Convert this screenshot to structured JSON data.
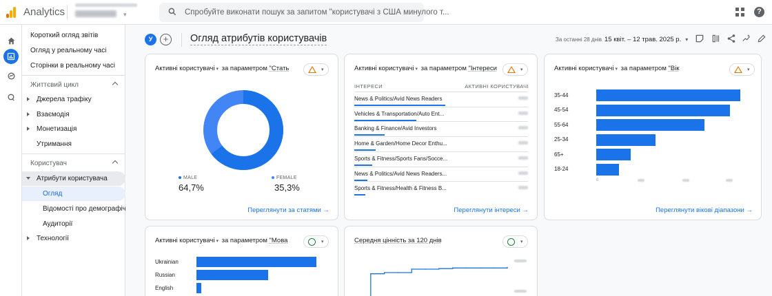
{
  "topbar": {
    "app_name": "Analytics",
    "search_placeholder": "Спробуйте виконати пошук за запитом \"користувачі з США минулого т...",
    "icons": [
      "analytics-logo-icon",
      "search-icon",
      "apps-grid-icon",
      "help-icon"
    ]
  },
  "rail": {
    "icons": [
      "home-icon",
      "reports-icon",
      "explore-icon",
      "advertising-icon"
    ]
  },
  "sidenav": {
    "items": [
      {
        "label": "Короткий огляд звітів"
      },
      {
        "label": "Огляд у реальному часі"
      },
      {
        "label": "Сторінки в реальному часі"
      },
      {
        "label": "Життєвий цикл"
      },
      {
        "label": "Джерела трафіку"
      },
      {
        "label": "Взаємодія"
      },
      {
        "label": "Монетизація"
      },
      {
        "label": "Утримання"
      },
      {
        "label": "Користувач"
      },
      {
        "label": "Атрибути користувача"
      },
      {
        "label": "Огляд"
      },
      {
        "label": "Відомості про демографіч..."
      },
      {
        "label": "Аудиторії"
      },
      {
        "label": "Технології"
      }
    ]
  },
  "header": {
    "avatar_letter": "У",
    "add_label": "+",
    "title": "Огляд атрибутів користувачів",
    "date_label": "За останні 28 днів",
    "date_value": "15 квіт. – 12 трав. 2025 р."
  },
  "cards": {
    "gender": {
      "metric": "Активні користувачі",
      "by": "за параметром",
      "dimension": "\"Стать",
      "status": "warning",
      "link": "Переглянути за статями →",
      "legend": [
        {
          "name": "MALE",
          "value": "64,7%",
          "color": "#1a73e8"
        },
        {
          "name": "FEMALE",
          "value": "35,3%",
          "color": "#4285f4"
        }
      ]
    },
    "interests": {
      "metric": "Активні користувачі",
      "by": "за параметром",
      "dimension": "\"Інтереси",
      "status": "warning",
      "col_name": "ІНТЕРЕСИ",
      "col_value": "АКТИВНІ КОРИСТУВАЧІ",
      "rows": [
        {
          "name": "News & Politics/Avid News Readers",
          "share": 0.97
        },
        {
          "name": "Vehicles & Transportation/Auto Ent...",
          "share": 0.66
        },
        {
          "name": "Banking & Finance/Avid Investors",
          "share": 0.32
        },
        {
          "name": "Home & Garden/Home Decor Enthu...",
          "share": 0.23
        },
        {
          "name": "Sports & Fitness/Sports Fans/Socce...",
          "share": 0.19
        },
        {
          "name": "News & Politics/Avid News Readers...",
          "share": 0.14
        },
        {
          "name": "Sports & Fitness/Health & Fitness B...",
          "share": 0.12
        }
      ],
      "link": "Переглянути інтереси →"
    },
    "age": {
      "metric": "Активні користувачі",
      "by": "за параметром",
      "dimension": "\"Вік",
      "status": "warning",
      "link": "Переглянути вікові діапазони →",
      "x_first_tick": "0"
    },
    "language": {
      "metric": "Активні користувачі",
      "by": "за параметром",
      "dimension": "\"Мова",
      "status": "ok"
    },
    "ltv": {
      "title": "Середня цінність за 120 днів",
      "status": "ok"
    }
  },
  "chart_data": [
    {
      "type": "pie",
      "categories": [
        "MALE",
        "FEMALE"
      ],
      "values": [
        64.7,
        35.3
      ]
    },
    {
      "type": "bar",
      "orientation": "horizontal",
      "categories": [
        "35-44",
        "45-54",
        "55-64",
        "25-34",
        "65+",
        "18-24"
      ],
      "values": [
        100,
        93,
        75,
        41,
        24,
        16
      ]
    },
    {
      "type": "bar",
      "orientation": "horizontal",
      "categories": [
        "Ukrainian",
        "Russian",
        "English"
      ],
      "values": [
        100,
        60,
        4
      ]
    },
    {
      "type": "line",
      "x": [
        0,
        1,
        2,
        3,
        4,
        5,
        6,
        7,
        8,
        9,
        10,
        11
      ],
      "values": [
        0,
        40,
        42,
        42,
        48,
        48,
        49,
        50,
        50,
        50,
        50,
        51
      ]
    }
  ],
  "colors": {
    "accent": "#1a73e8",
    "warning": "#e37400",
    "ok": "#188038"
  }
}
